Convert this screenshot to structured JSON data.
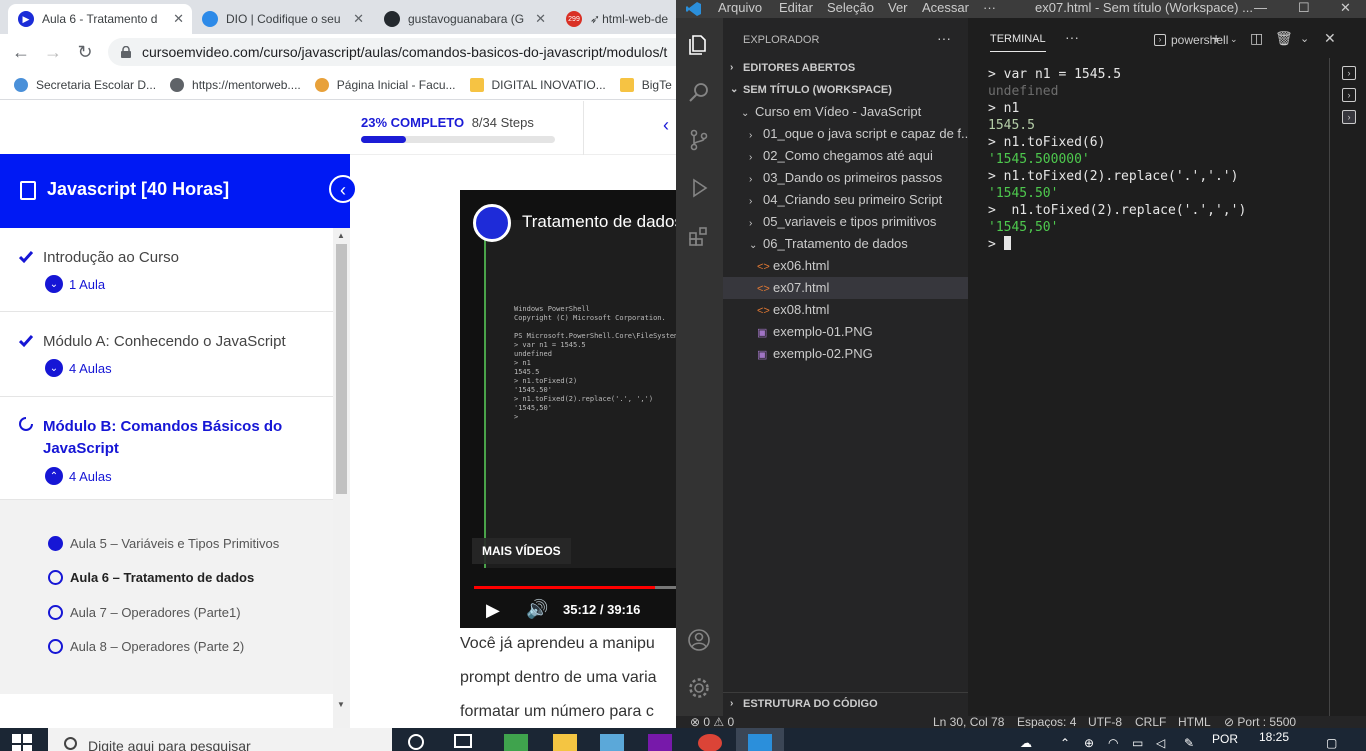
{
  "browser": {
    "tabs": [
      {
        "title": "Aula 6 - Tratamento d",
        "active": true
      },
      {
        "title": "DIO | Codifique o seu",
        "active": false
      },
      {
        "title": "gustavoguanabara (G",
        "active": false
      },
      {
        "title": "html-web-de",
        "active": false,
        "badge": "299"
      }
    ],
    "url": "cursoemvideo.com/curso/javascript/aulas/comandos-basicos-do-javascript/modulos/t",
    "bookmarks": [
      "Secretaria Escolar D...",
      "https://mentorweb....",
      "Página Inicial - Facu...",
      "DIGITAL INOVATIO...",
      "BigTe"
    ]
  },
  "course": {
    "progress_label": "23% COMPLETO",
    "progress_steps": "8/34 Steps",
    "progress_fraction": 0.23,
    "title": "Javascript [40 Horas]",
    "modules": [
      {
        "title": "Introdução ao Curso",
        "count": "1 Aula"
      },
      {
        "title": "Módulo A: Conhecendo o JavaScript",
        "count": "4 Aulas"
      },
      {
        "title": "Módulo B: Comandos Básicos do JavaScript",
        "count": "4 Aulas"
      }
    ],
    "lessons": [
      "Aula 5 – Variáveis e Tipos Primitivos",
      "Aula 6 – Tratamento de dados",
      "Aula 7 – Operadores (Parte1)",
      "Aula 8 – Operadores (Parte 2)"
    ]
  },
  "video": {
    "title": "Tratamento de dados",
    "mais_videos": "MAIS VÍDEOS",
    "time": "35:12 / 39:16",
    "progress_fraction": 0.896
  },
  "content": {
    "para_lines": [
      "Você já aprendeu a manipu",
      "prompt dentro de uma varia",
      "formatar um número para c"
    ]
  },
  "vscode": {
    "menu": [
      "Arquivo",
      "Editar",
      "Seleção",
      "Ver",
      "Acessar",
      "···"
    ],
    "window_title": "ex07.html - Sem título (Workspace) ...",
    "explorer_title": "EXPLORADOR",
    "sections": [
      "EDITORES ABERTOS",
      "SEM TÍTULO (WORKSPACE)",
      "ESTRUTURA DO CÓDIGO"
    ],
    "root_folder": "Curso em Vídeo - JavaScript",
    "folders": [
      "01_oque o java script e capaz de f...",
      "02_Como chegamos até aqui",
      "03_Dando os primeiros passos",
      "04_Criando seu primeiro Script",
      "05_variaveis e tipos primitivos",
      "06_Tratamento de dados"
    ],
    "files": [
      "ex06.html",
      "ex07.html",
      "ex08.html",
      "exemplo-01.PNG",
      "exemplo-02.PNG"
    ],
    "terminal_tab": "TERMINAL",
    "shell": "powershell",
    "terminal_lines": [
      {
        "text": "> var n1 = 1545.5",
        "kind": "prompt"
      },
      {
        "text": "undefined",
        "kind": "undef"
      },
      {
        "text": "> n1",
        "kind": "prompt"
      },
      {
        "text": "1545.5",
        "kind": "num"
      },
      {
        "text": "> n1.toFixed(6)",
        "kind": "prompt"
      },
      {
        "text": "'1545.500000'",
        "kind": "str"
      },
      {
        "text": "> n1.toFixed(2).replace('.','.')",
        "kind": "prompt"
      },
      {
        "text": "'1545.50'",
        "kind": "str"
      },
      {
        "text": ">  n1.toFixed(2).replace('.',',')",
        "kind": "prompt"
      },
      {
        "text": "'1545,50'",
        "kind": "str"
      },
      {
        "text": "> ",
        "kind": "prompt"
      }
    ],
    "status": {
      "problems": "⊗ 0 ⚠ 0",
      "position": "Ln 30, Col 78",
      "spaces": "Espaços: 4",
      "encoding": "UTF-8",
      "eol": "CRLF",
      "lang": "HTML",
      "port": "⊘ Port : 5500"
    }
  },
  "taskbar": {
    "search_placeholder": "Digite aqui para pesquisar",
    "lang": "POR",
    "time": "18:25"
  }
}
